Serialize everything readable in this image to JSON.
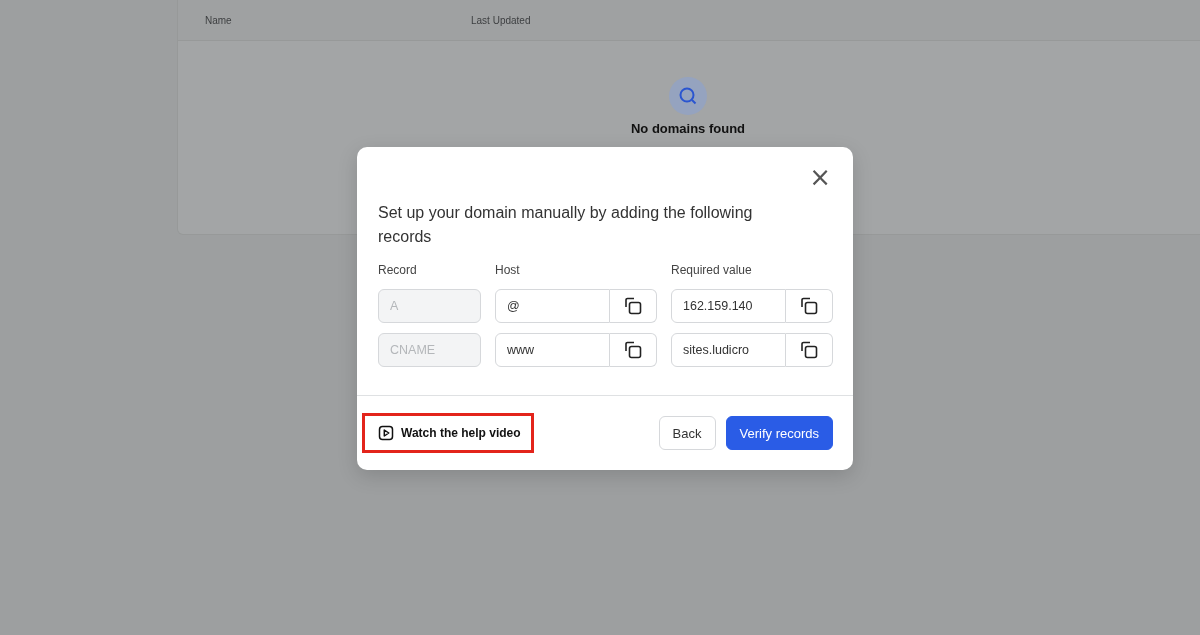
{
  "table": {
    "columns": [
      "Name",
      "Last Updated"
    ],
    "empty_state": {
      "message": "No domains found"
    }
  },
  "dialog": {
    "close": "×",
    "title": "Set up your domain manually by adding the following records",
    "columns": [
      "Record",
      "Host",
      "Required value"
    ],
    "records": [
      {
        "record": "A",
        "record_disabled": true,
        "host": "@",
        "value": "162.159.140"
      },
      {
        "record": "CNAME",
        "record_disabled": true,
        "host": "www",
        "value": "sites.ludicro"
      }
    ],
    "help_link": {
      "label": "Watch the help video",
      "highlighted": true
    },
    "buttons": [
      {
        "label": "Back",
        "kind": "secondary"
      },
      {
        "label": "Verify records",
        "kind": "primary"
      }
    ]
  }
}
